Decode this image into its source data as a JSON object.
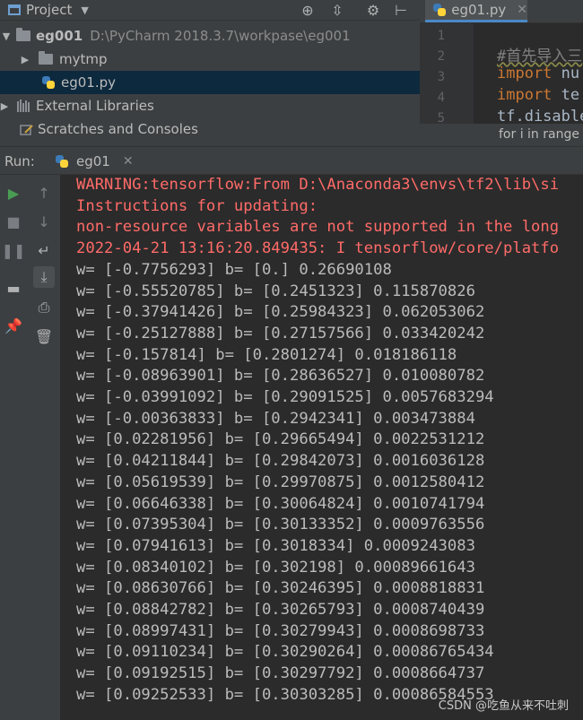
{
  "project_panel": {
    "title": "Project",
    "tree": [
      {
        "label": "eg001",
        "path": "D:\\PyCharm  2018.3.7\\workpase\\eg001"
      },
      {
        "label": "mytmp"
      },
      {
        "label": "eg01.py"
      },
      {
        "label": "External Libraries"
      },
      {
        "label": "Scratches and Consoles"
      }
    ]
  },
  "editor": {
    "tab_label": "eg01.py",
    "line_numbers": [
      "1",
      "2",
      "3",
      "4",
      "5"
    ],
    "lines": [
      {
        "text": ""
      },
      {
        "text": "#首先导入三"
      },
      {
        "keyword": "import",
        "rest": " nu"
      },
      {
        "keyword": "import",
        "rest": " te"
      },
      {
        "text": "tf.disable"
      }
    ],
    "breadcrumb": "for i in range"
  },
  "run_panel": {
    "label": "Run:",
    "tab_label": "eg01"
  },
  "console": {
    "error_lines": [
      "WARNING:tensorflow:From D:\\Anaconda3\\envs\\tf2\\lib\\si",
      "Instructions for updating:",
      "non-resource variables are not supported in the long",
      "2022-04-21 13:16:20.849435: I tensorflow/core/platfo"
    ],
    "output_lines": [
      "w= [-0.7756293] b= [0.] 0.26690108",
      "w= [-0.55520785] b= [0.2451323] 0.115870826",
      "w= [-0.37941426] b= [0.25984323] 0.062053062",
      "w= [-0.25127888] b= [0.27157566] 0.033420242",
      "w= [-0.157814] b= [0.2801274] 0.018186118",
      "w= [-0.08963901] b= [0.28636527] 0.010080782",
      "w= [-0.03991092] b= [0.29091525] 0.0057683294",
      "w= [-0.00363833] b= [0.2942341] 0.003473884",
      "w= [0.02281956] b= [0.29665494] 0.0022531212",
      "w= [0.04211844] b= [0.29842073] 0.0016036128",
      "w= [0.05619539] b= [0.29970875] 0.0012580412",
      "w= [0.06646338] b= [0.30064824] 0.0010741794",
      "w= [0.07395304] b= [0.30133352] 0.0009763556",
      "w= [0.07941613] b= [0.3018334] 0.0009243083",
      "w= [0.08340102] b= [0.302198] 0.00089661643",
      "w= [0.08630766] b= [0.30246395] 0.0008818831",
      "w= [0.08842782] b= [0.30265793] 0.0008740439",
      "w= [0.08997431] b= [0.30279943] 0.0008698733",
      "w= [0.09110234] b= [0.30290264] 0.00086765434",
      "w= [0.09192515] b= [0.30297792] 0.0008664737",
      "w= [0.09252533] b= [0.30303285] 0.00086584553"
    ]
  },
  "watermark": "CSDN @吃鱼从来不吐刺",
  "colors": {
    "error": "#ff6b68",
    "output": "#bbbbbb",
    "keyword": "#cc7832",
    "run_green": "#499c54",
    "selection": "#0d293e"
  },
  "icons": {
    "run_toolbar": [
      "run-icon",
      "stop-icon",
      "pause-icon",
      "layout-icon",
      "pin-icon"
    ],
    "console_toolbar": [
      "up-arrow-icon",
      "down-arrow-icon",
      "soft-wrap-icon",
      "scroll-to-end-icon",
      "print-icon",
      "trash-icon"
    ]
  }
}
